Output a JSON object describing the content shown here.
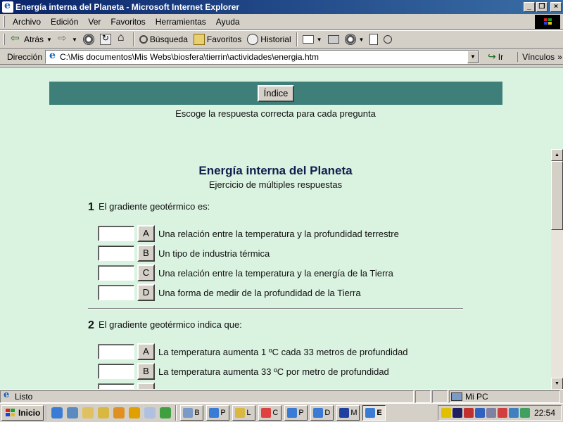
{
  "window": {
    "title": "Energía interna del Planeta - Microsoft Internet Explorer",
    "minimize_label": "_",
    "maximize_label": "❐",
    "close_label": "×"
  },
  "menu": {
    "items": [
      "Archivo",
      "Edición",
      "Ver",
      "Favoritos",
      "Herramientas",
      "Ayuda"
    ]
  },
  "toolbar": {
    "back_label": "Atrás",
    "search_label": "Búsqueda",
    "favorites_label": "Favoritos",
    "history_label": "Historial"
  },
  "address": {
    "label": "Dirección",
    "value": "C:\\Mis documentos\\Mis Webs\\biosfera\\tierrin\\actividades\\energia.htm",
    "go_label": "Ir",
    "links_label": "Vínculos"
  },
  "page": {
    "index_button": "Índice",
    "instructions": "Escoge la respuesta correcta para cada pregunta",
    "title": "Energía interna del Planeta",
    "subtitle": "Ejercicio de múltiples respuestas",
    "questions": [
      {
        "number": "1",
        "text": "El gradiente geotérmico es:",
        "options": [
          {
            "letter": "A",
            "text": "Una relación entre la temperatura y la profundidad terrestre"
          },
          {
            "letter": "B",
            "text": "Un tipo de industria térmica"
          },
          {
            "letter": "C",
            "text": "Una relación entre la temperatura y la energía de la Tierra"
          },
          {
            "letter": "D",
            "text": "Una forma de medir de la profundidad de la Tierra"
          }
        ]
      },
      {
        "number": "2",
        "text": "El gradiente geotérmico indica que:",
        "options": [
          {
            "letter": "A",
            "text": "La temperatura aumenta 1 ºC cada 33 metros de profundidad"
          },
          {
            "letter": "B",
            "text": "La temperatura aumenta 33 ºC por metro de profundidad"
          }
        ]
      }
    ]
  },
  "status": {
    "text": "Listo",
    "zone": "Mi PC"
  },
  "taskbar": {
    "start_label": "Inicio",
    "tasks": [
      "B",
      "P",
      "L",
      "C",
      "P",
      "D",
      "M",
      "E"
    ],
    "clock": "22:54"
  }
}
